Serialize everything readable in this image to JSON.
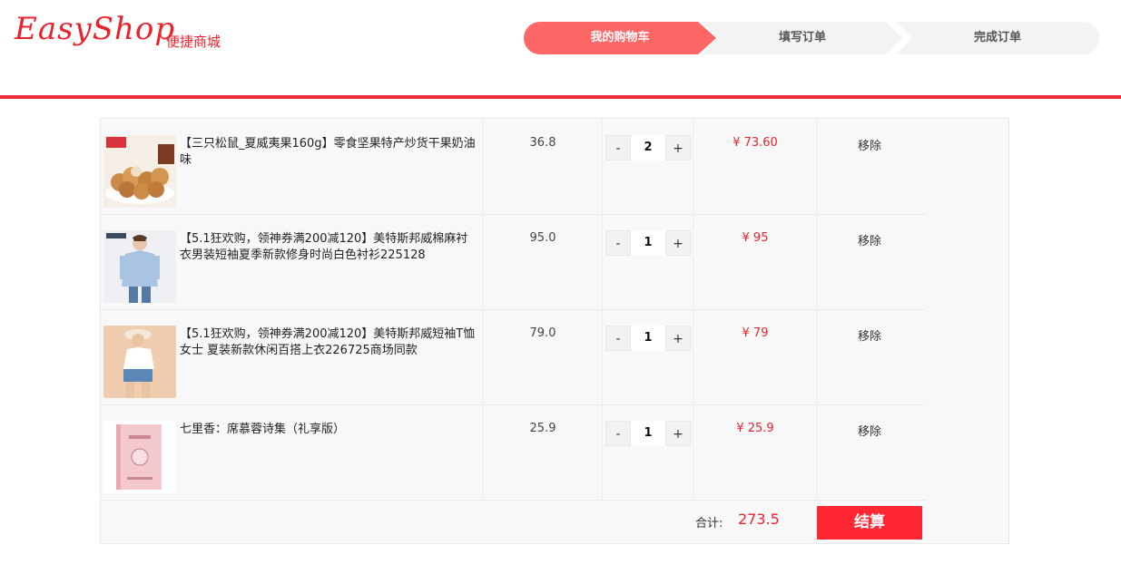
{
  "header": {
    "logo": "EasyShop",
    "logo_sub": "便捷商城",
    "steps": [
      "我的购物车",
      "填写订单",
      "完成订单"
    ]
  },
  "cart": {
    "items": [
      {
        "name": "【三只松鼠_夏威夷果160g】零食坚果特产炒货干果奶油味",
        "price": "36.8",
        "qty": "2",
        "subtotal": "¥ 73.60",
        "remove": "移除"
      },
      {
        "name": "【5.1狂欢购，领神券满200减120】美特斯邦威棉麻衬衣男装短袖夏季新款修身时尚白色衬衫225128",
        "price": "95.0",
        "qty": "1",
        "subtotal": "¥ 95",
        "remove": "移除"
      },
      {
        "name": "【5.1狂欢购，领神券满200减120】美特斯邦威短袖T恤女士 夏装新款休闲百搭上衣226725商场同款",
        "price": "79.0",
        "qty": "1",
        "subtotal": "¥ 79",
        "remove": "移除"
      },
      {
        "name": "七里香：席慕蓉诗集（礼享版）",
        "price": "25.9",
        "qty": "1",
        "subtotal": "¥ 25.9",
        "remove": "移除"
      }
    ],
    "minus": "-",
    "plus": "+",
    "total_label": "合计:",
    "total_value": "273.5",
    "checkout": "结算"
  },
  "colors": {
    "accent": "#e8232e",
    "step_active": "#ff6767",
    "checkout_bg": "#ff2732"
  }
}
